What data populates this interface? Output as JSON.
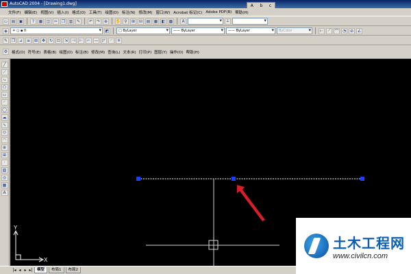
{
  "window": {
    "title": "AutoCAD 2004 - [Drawing1.dwg]"
  },
  "menubar": [
    "文件(F)",
    "编辑(E)",
    "视图(V)",
    "插入(I)",
    "格式(O)",
    "工具(T)",
    "绘图(D)",
    "标注(N)",
    "修改(M)",
    "窗口(W)",
    "Acrobat 标记(C)",
    "Adobe PDF(B)",
    "帮助(H)"
  ],
  "float_palette": [
    "A",
    "b",
    "c"
  ],
  "properties": {
    "color": "ByLayer",
    "linetype": "ByLayer",
    "lineweight": "ByLayer",
    "plotstyle": "ByColor"
  },
  "layer": {
    "current": "0"
  },
  "menu2": [
    "格式(O)",
    "符号(E)",
    "表格(B)",
    "绘图(D)",
    "标注(B)",
    "修改(M)",
    "查询(L)",
    "文本(R)",
    "打印(P)",
    "图层(Y)",
    "操作(O)",
    "帮助(H)"
  ],
  "layout_tabs": [
    "模型",
    "布局1",
    "布局2"
  ],
  "ucs": {
    "x_label": "X",
    "y_label": "Y"
  },
  "watermark": {
    "name": "土木工程网",
    "url": "www.civilcn.com"
  },
  "colors": {
    "canvas": "#000000",
    "grip": "#1c3cff",
    "selected_line": "#ffffff",
    "crosshair": "#ffffff",
    "annotation_arrow": "#d81e2a",
    "ucs": "#ffffff"
  },
  "icons": [
    "new-icon",
    "open-icon",
    "save-icon",
    "print-icon",
    "undo-icon",
    "redo-icon",
    "pan-icon",
    "zoom-icon",
    "layer-icon",
    "line-icon",
    "polyline-icon",
    "circle-icon",
    "arc-icon",
    "rectangle-icon",
    "text-icon"
  ]
}
